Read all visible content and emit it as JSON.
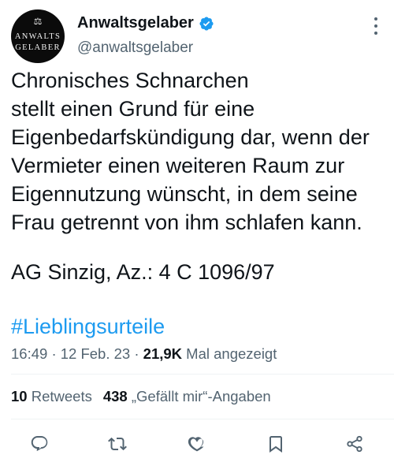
{
  "account": {
    "display_name": "Anwaltsgelaber",
    "handle": "@anwaltsgelaber",
    "avatar_line1": "ANWALTS",
    "avatar_line2": "GELABER",
    "avatar_symbol": "⚖"
  },
  "tweet": {
    "text": "Chronisches Schnarchen\nstellt einen Grund für eine\nEigenbedarfskündigung dar, wenn der\nVermieter einen weiteren Raum zur\nEigennutzung wünscht, in dem seine\nFrau getrennt von ihm schlafen kann.",
    "citation": "AG Sinzig, Az.: 4 C 1096/97",
    "hashtag": "#Lieblingsurteile"
  },
  "meta": {
    "time": "16:49",
    "separator": "·",
    "date": "12 Feb. 23",
    "views_count": "21,9K",
    "views_label": "Mal angezeigt"
  },
  "stats": {
    "retweets_count": "10",
    "retweets_label": "Retweets",
    "likes_count": "438",
    "likes_label": "„Gefällt mir“-Angaben"
  },
  "icons": {
    "verified": "verified-badge-icon",
    "more": "more-options-icon",
    "reply": "reply-icon",
    "retweet": "retweet-icon",
    "like": "heart-icon",
    "bookmark": "bookmark-icon",
    "share": "share-icon"
  },
  "colors": {
    "text": "#0f1419",
    "secondary": "#536471",
    "link": "#1d9bf0",
    "divider": "#eff3f4"
  }
}
